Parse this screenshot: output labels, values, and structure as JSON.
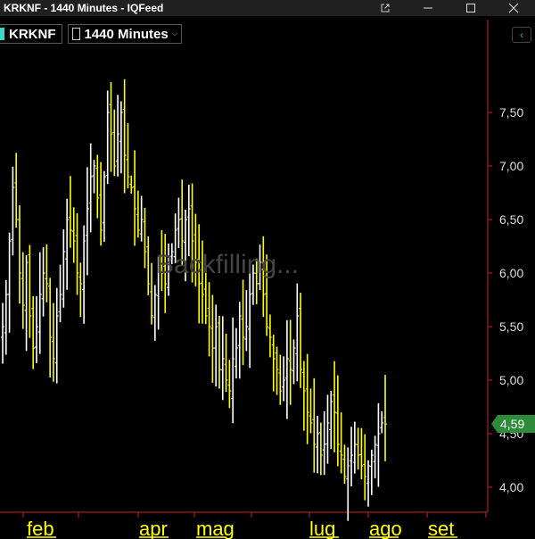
{
  "window": {
    "title": "KRKNF - 1440 Minutes - IQFeed",
    "controls": [
      "external-link-icon",
      "minimize-icon",
      "maximize-icon",
      "close-icon"
    ]
  },
  "toolbar": {
    "symbol": "KRKNF",
    "symbol_color": "#38d8c8",
    "interval": "1440 Minutes",
    "collapse_icon": "chevron-left-icon"
  },
  "watermark": "Backfilling...",
  "price_axis": {
    "ticks": [
      "7,50",
      "7,00",
      "6,50",
      "6,00",
      "5,50",
      "5,00",
      "4,50",
      "4,00"
    ],
    "last_price": "4,59",
    "last_price_color": "#2e8b3a"
  },
  "time_axis": {
    "labels": [
      "feb",
      "apr",
      "mag",
      "lug",
      "ago",
      "set"
    ],
    "label_color": "#ffff00"
  },
  "colors": {
    "up": "#ffffff",
    "down": "#ffff00",
    "grid": "#c8202a"
  },
  "chart_data": {
    "type": "bar",
    "style": "ohlc-daily",
    "symbol": "KRKNF",
    "ylim": [
      3.9,
      8.0
    ],
    "yticks": [
      7.5,
      7.0,
      6.5,
      6.0,
      5.5,
      5.0,
      4.5,
      4.0
    ],
    "xlabels": [
      "feb",
      "apr",
      "mag",
      "lug",
      "ago",
      "set"
    ],
    "last": 4.59,
    "closes": [
      5.5,
      5.8,
      6.3,
      6.8,
      6.5,
      6.0,
      5.7,
      6.1,
      5.6,
      5.3,
      5.5,
      5.8,
      6.0,
      5.9,
      5.4,
      5.2,
      5.6,
      5.8,
      6.2,
      6.5,
      6.4,
      6.3,
      6.0,
      5.9,
      6.3,
      6.6,
      6.9,
      7.0,
      6.7,
      6.4,
      6.9,
      7.5,
      7.3,
      7.0,
      7.3,
      7.5,
      7.1,
      6.9,
      6.8,
      6.6,
      6.4,
      6.5,
      6.2,
      5.9,
      5.6,
      5.8,
      6.1,
      6.0,
      5.9,
      6.1,
      6.2,
      6.4,
      6.5,
      6.3,
      6.5,
      6.6,
      6.3,
      6.1,
      5.9,
      5.8,
      5.6,
      5.5,
      5.3,
      5.5,
      5.1,
      5.2,
      5.0,
      4.9,
      5.2,
      5.3,
      5.6,
      5.4,
      5.5,
      5.8,
      6.0,
      5.9,
      6.1,
      5.8,
      5.5,
      5.4,
      5.2,
      5.1,
      4.9,
      5.0,
      5.2,
      5.1,
      5.3,
      5.6,
      5.1,
      4.9,
      4.7,
      4.6,
      4.4,
      4.5,
      4.3,
      4.4,
      4.6,
      4.8,
      4.7,
      4.4,
      4.3,
      4.1,
      4.2,
      4.3,
      4.4,
      4.3,
      4.2,
      4.1,
      4.2,
      4.3,
      4.4,
      4.5,
      4.6,
      4.59
    ]
  }
}
